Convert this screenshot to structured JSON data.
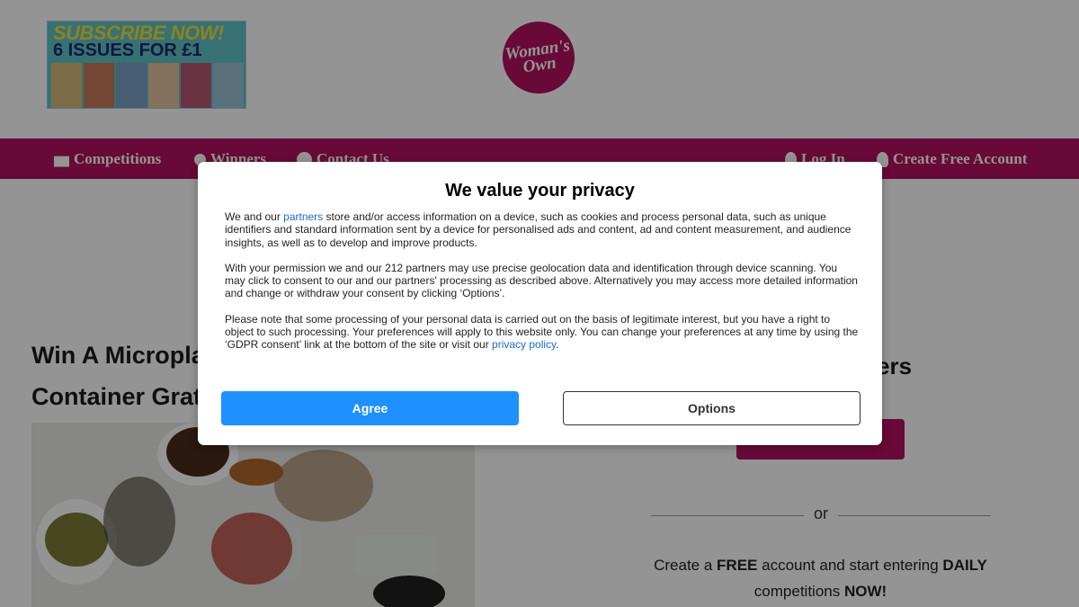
{
  "banner": {
    "line1": "SUBSCRIBE NOW!",
    "line2": "6 ISSUES FOR £1"
  },
  "logo": {
    "line1": "Woman's",
    "line2": "Own"
  },
  "nav": {
    "competitions": "Competitions",
    "winners": "Winners",
    "contact": "Contact Us",
    "login": "Log In",
    "create_account": "Create Free Account"
  },
  "article": {
    "title_line1": "Win A Micropla",
    "title_line2": "Container Grat"
  },
  "sidebar": {
    "heading": "ers",
    "or": "or",
    "cta_pre": "Create a ",
    "cta_free": "FREE",
    "cta_mid": " account and start entering ",
    "cta_daily": "DAILY",
    "cta_mid2": " competitions ",
    "cta_now": "NOW!"
  },
  "consent": {
    "title": "We value your privacy",
    "p1_a": "We and our ",
    "p1_link": "partners",
    "p1_b": " store and/or access information on a device, such as cookies and process personal data, such as unique identifiers and standard information sent by a device for personalised ads and content, ad and content measurement, and audience insights, as well as to develop and improve products.",
    "p2": "With your permission we and our 212 partners may use precise geolocation data and identification through device scanning. You may click to consent to our and our partners' processing as described above. Alternatively you may access more detailed information and change or withdraw your consent by clicking ‘Options’.",
    "p3_a": "Please note that some processing of your personal data is carried out on the basis of legitimate interest, but you have a right to object to such processing. Your preferences will apply to this website only. You can change your preferences at any time by using the ‘GDPR consent’ link at the bottom of the site or visit our ",
    "p3_link": "privacy policy",
    "p3_b": ".",
    "agree": "Agree",
    "options": "Options"
  },
  "colors": {
    "brand": "#b4105f",
    "agree": "#1e90ff",
    "link": "#1a6bd0"
  }
}
